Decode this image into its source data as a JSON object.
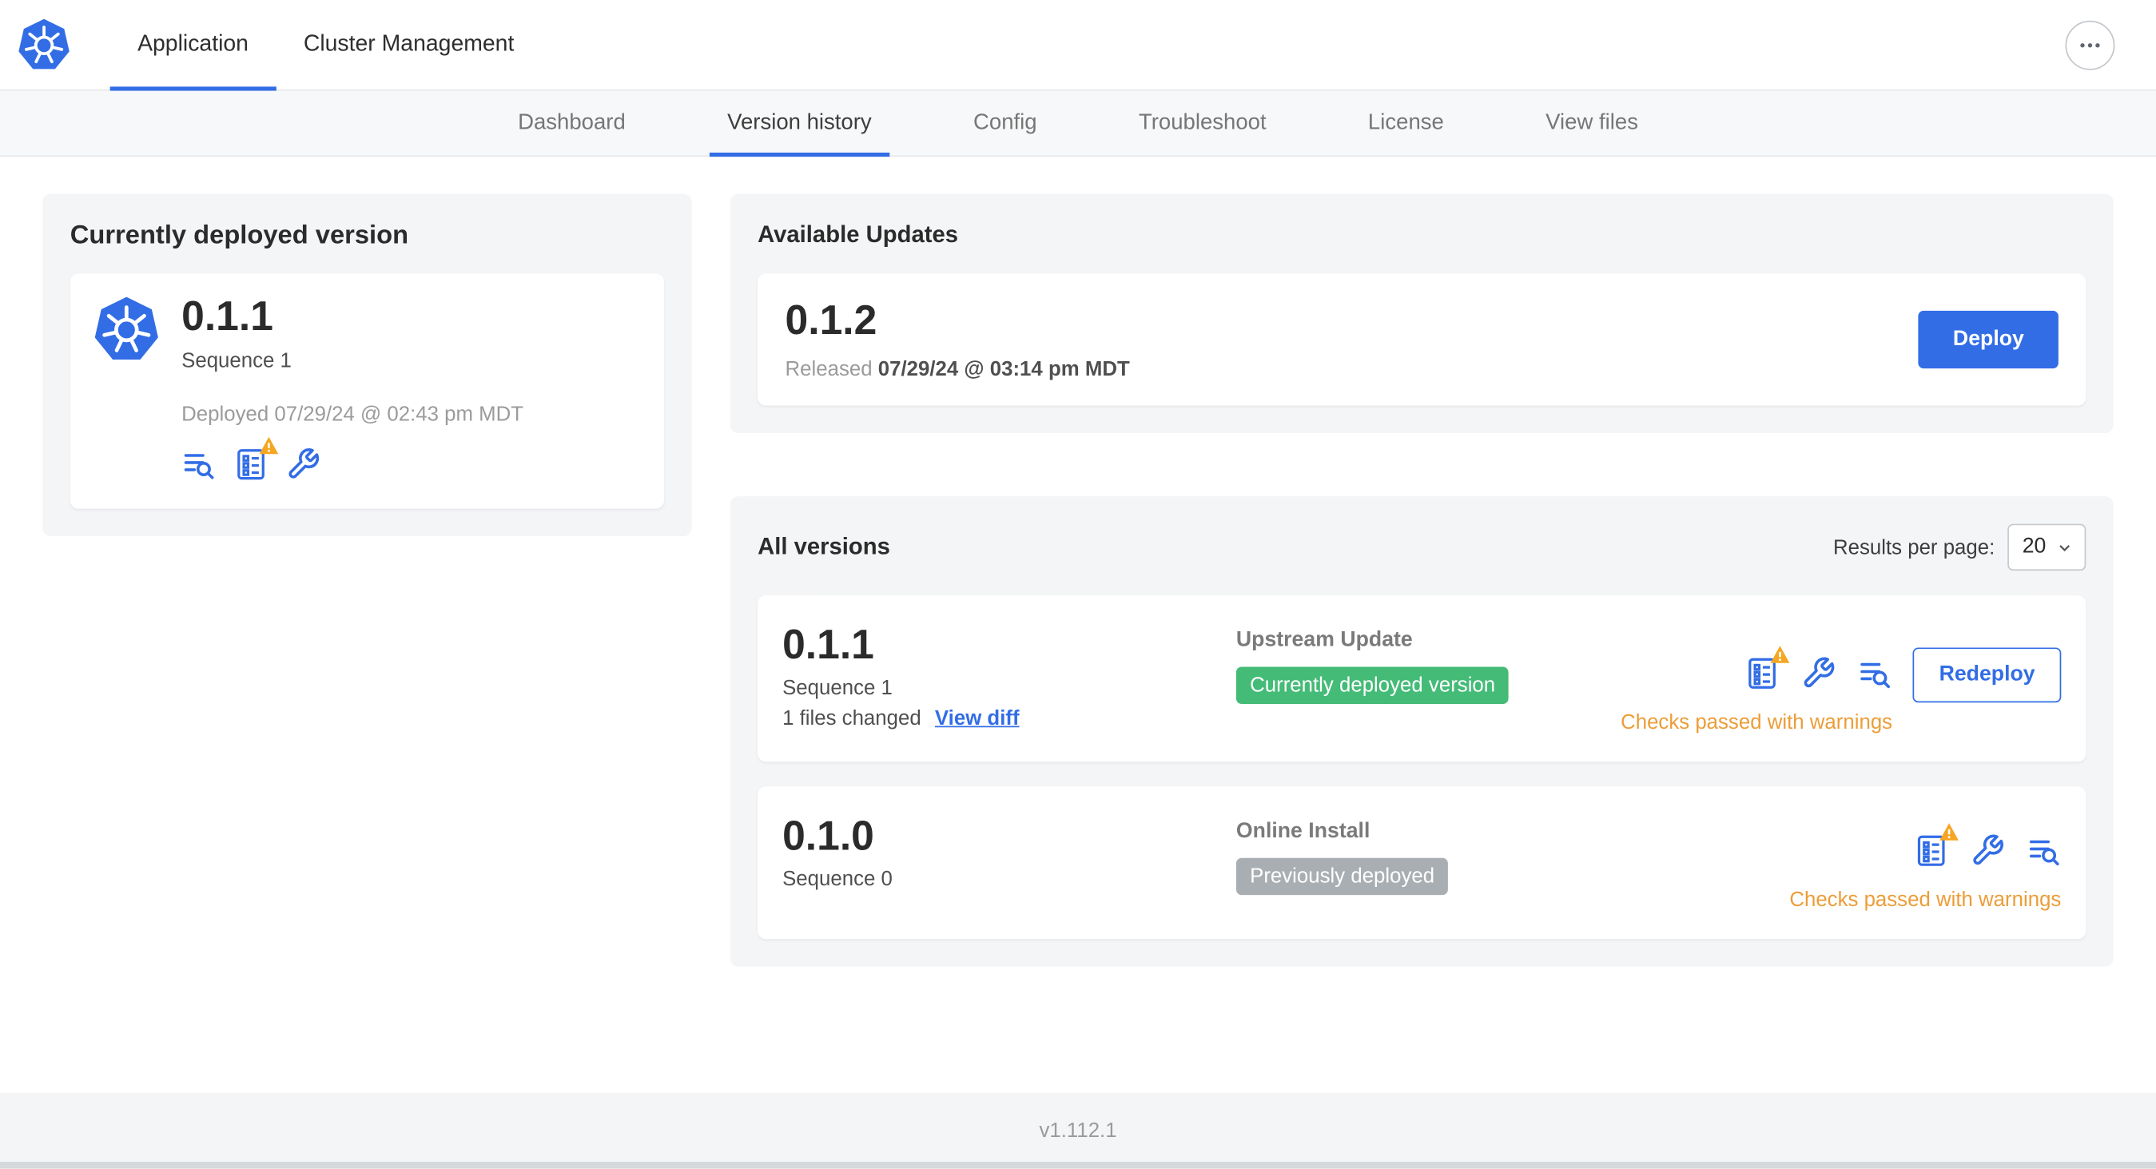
{
  "colors": {
    "accent_blue": "#326de6",
    "badge_green_bg": "#44bb77",
    "badge_gray_bg": "#a9aeb2",
    "warning_text": "#ec9d38",
    "warning_triangle": "#f5a623"
  },
  "header": {
    "tabs": [
      {
        "label": "Application",
        "active": true
      },
      {
        "label": "Cluster Management",
        "active": false
      }
    ]
  },
  "subnav": {
    "items": [
      {
        "label": "Dashboard"
      },
      {
        "label": "Version history"
      },
      {
        "label": "Config"
      },
      {
        "label": "Troubleshoot"
      },
      {
        "label": "License"
      },
      {
        "label": "View files"
      }
    ],
    "active": "Version history"
  },
  "currently_deployed": {
    "title": "Currently deployed version",
    "version": "0.1.1",
    "sequence": "Sequence 1",
    "deployed_at": "Deployed 07/29/24 @ 02:43 pm MDT"
  },
  "available_updates": {
    "title": "Available Updates",
    "version": "0.1.2",
    "released_label": "Released",
    "released_at": "07/29/24 @ 03:14 pm MDT",
    "deploy_button": "Deploy"
  },
  "all_versions": {
    "title": "All versions",
    "results_per_page_label": "Results per page:",
    "results_per_page_value": "20",
    "rows": [
      {
        "version": "0.1.1",
        "sequence": "Sequence 1",
        "files_changed": "1 files changed",
        "view_diff_link": "View diff",
        "source": "Upstream Update",
        "badge": "Currently deployed version",
        "action_button": "Redeploy",
        "status": "Checks passed with warnings"
      },
      {
        "version": "0.1.0",
        "sequence": "Sequence 0",
        "source": "Online Install",
        "badge": "Previously deployed",
        "status": "Checks passed with warnings"
      }
    ]
  },
  "footer": {
    "version": "v1.112.1"
  }
}
